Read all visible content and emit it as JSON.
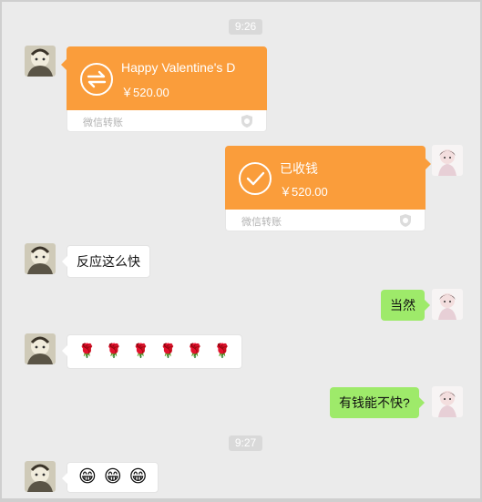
{
  "timestamps": [
    "9:26",
    "9:27"
  ],
  "messages": {
    "transfer_sent": {
      "title": "Happy Valentine's D",
      "amount": "￥520.00",
      "footer": "微信转账"
    },
    "transfer_received": {
      "title": "已收钱",
      "amount": "￥520.00",
      "footer": "微信转账"
    },
    "text_1": "反应这么快",
    "text_2": "当然",
    "roses": [
      "🌹",
      "🌹",
      "🌹",
      "🌹",
      "🌹",
      "🌹"
    ],
    "text_3": "有钱能不快?",
    "grins": [
      "😁",
      "😁",
      "😁"
    ]
  },
  "colors": {
    "background": "#ebebeb",
    "transfer_orange": "#fa9d3b",
    "self_bubble": "#9eea6a",
    "other_bubble": "#ffffff"
  },
  "icons": {
    "transfer": "transfer-arrows-icon",
    "received": "checkmark-circle-icon",
    "shield": "wechat-pay-shield-icon",
    "rose": "rose-emoji",
    "grin": "grinning-emoji"
  }
}
